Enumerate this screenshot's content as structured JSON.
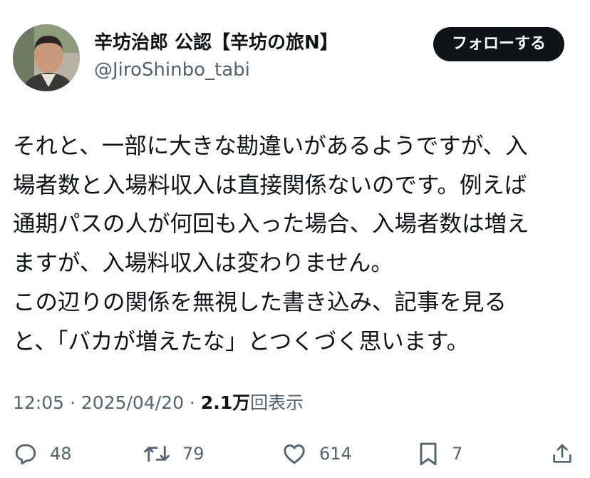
{
  "author": {
    "display_name": "辛坊治郎 公認【辛坊の旅N】",
    "handle": "@JiroShinbo_tabi"
  },
  "follow_label": "フォローする",
  "tweet": {
    "lines": [
      "それと、一部に大きな勘違いがあるようですが、入",
      "場者数と入場料収入は直接関係ないのです。例えば",
      "通期パスの人が何回も入った場合、入場者数は増え",
      "ますが、入場料収入は変わりません。",
      "この辺りの関係を無視した書き込み、記事を見る",
      "と、「バカが増えたな」とつくづく思います。"
    ]
  },
  "meta": {
    "time": "12:05",
    "separator": " · ",
    "date": "2025/04/20",
    "views_count": "2.1万",
    "views_label": "回表示"
  },
  "actions": {
    "replies": "48",
    "reposts": "79",
    "likes": "614",
    "bookmarks": "7"
  },
  "icons": {
    "reply": "reply-icon",
    "repost": "repost-icon",
    "like": "heart-icon",
    "bookmark": "bookmark-icon",
    "share": "share-icon"
  },
  "colors": {
    "text": "#0f1419",
    "secondary": "#536471",
    "button_bg": "#0f1419",
    "button_text": "#ffffff",
    "icon": "#536471"
  }
}
